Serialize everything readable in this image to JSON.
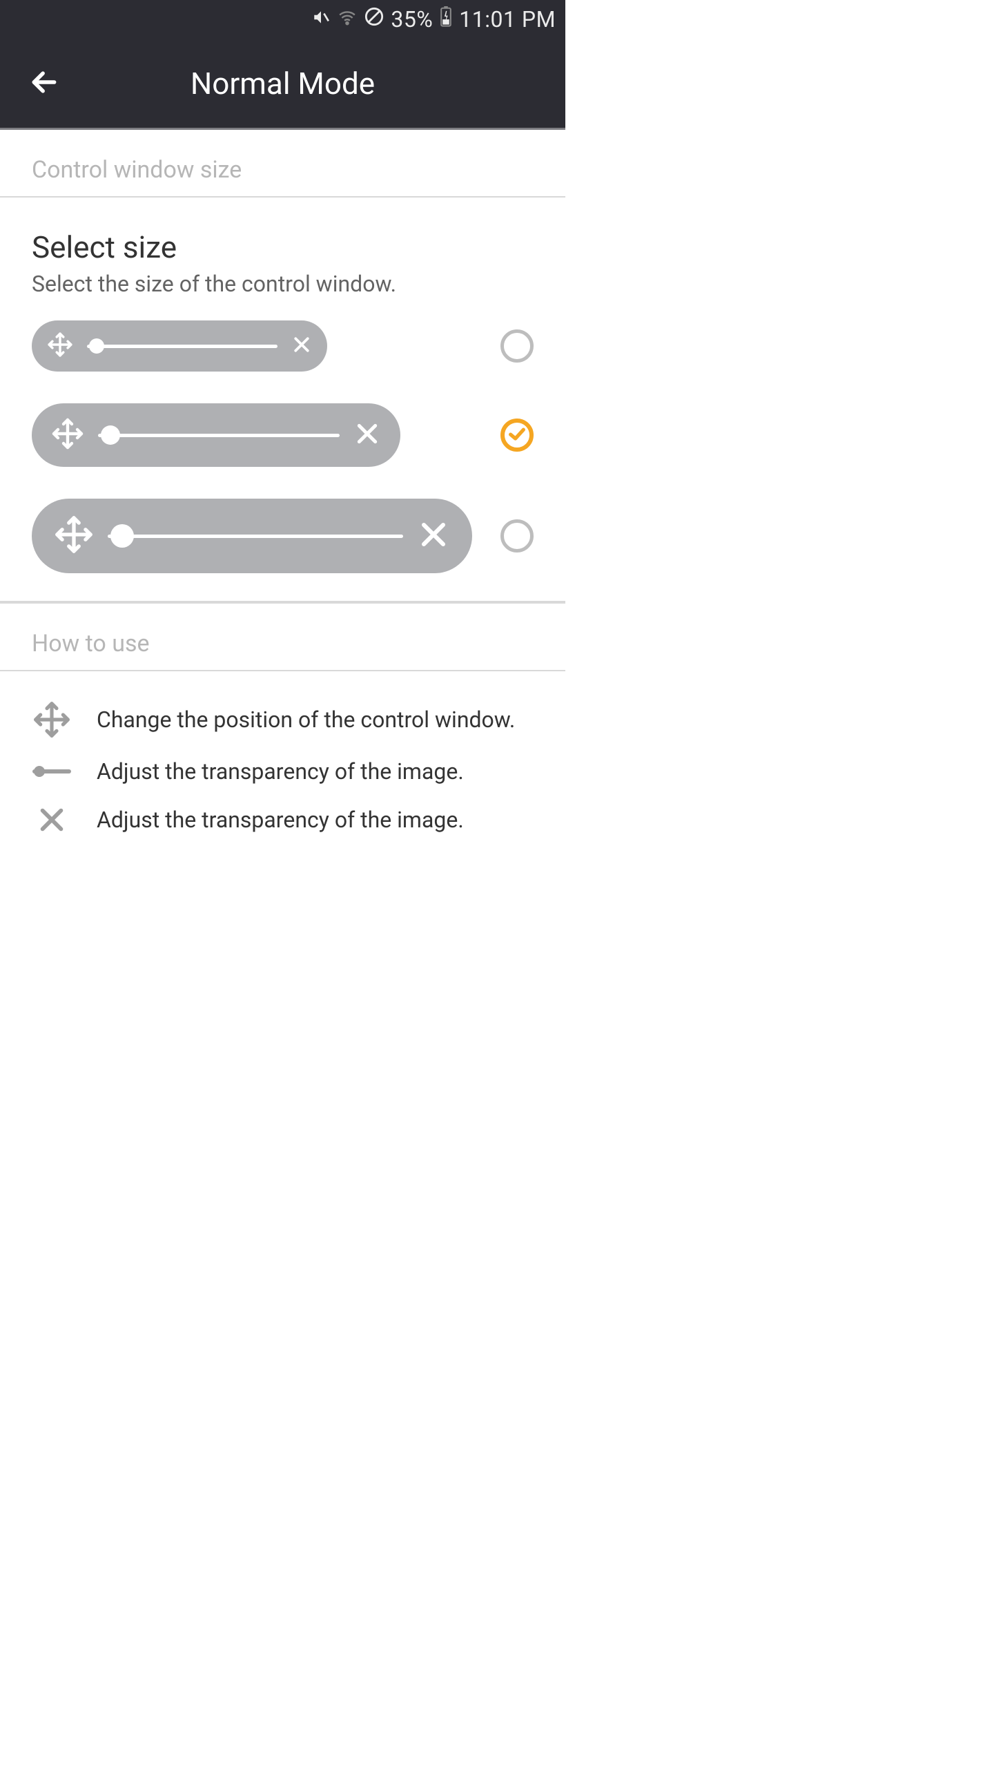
{
  "status_bar": {
    "battery_pct": "35%",
    "time": "11:01 PM"
  },
  "app_bar": {
    "title": "Normal Mode"
  },
  "section1": {
    "heading": "Control window size",
    "title": "Select size",
    "description": "Select the size of the control window."
  },
  "options": {
    "selected_index": 1
  },
  "section2": {
    "heading": "How to use",
    "items": [
      {
        "text": "Change the position of the control window."
      },
      {
        "text": "Adjust the transparency of the image."
      },
      {
        "text": "Adjust the transparency of the image."
      }
    ]
  }
}
